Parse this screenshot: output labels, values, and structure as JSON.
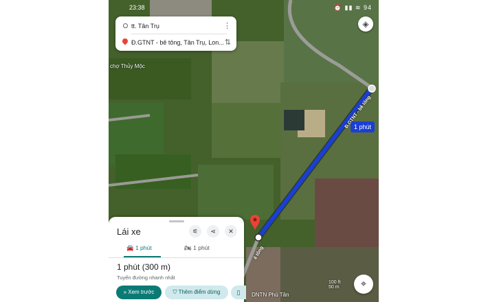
{
  "status_bar": {
    "time": "23:38",
    "battery": "94"
  },
  "search": {
    "origin": "tt. Tân Trụ",
    "destination": "Đ.GTNT - bê tông, Tân Trụ, Lon...",
    "more_icon": "more-vert-icon",
    "swap_icon": "swap-icon"
  },
  "map": {
    "eta_label": "1 phút",
    "road_label": "Đ.GTNT - bê tông",
    "road_label_2": "ê tông",
    "place_1": "chợ Thủy Mộc",
    "place_2": "DNTN Phú Tân",
    "scale_ft": "100 ft",
    "scale_m": "50 m",
    "route_color": "#1b3fd2"
  },
  "sheet": {
    "title": "Lái xe",
    "tabs": [
      {
        "label": "1 phút",
        "icon": "car-icon",
        "active": true
      },
      {
        "label": "1 phút",
        "icon": "motorbike-icon",
        "active": false
      }
    ],
    "duration": "1 phút (300 m)",
    "subtitle": "Tuyến đường nhanh nhất",
    "preview_btn": "Xem trước",
    "add_stop_btn": "Thêm điểm dừng",
    "accent": "#0b7a75"
  }
}
